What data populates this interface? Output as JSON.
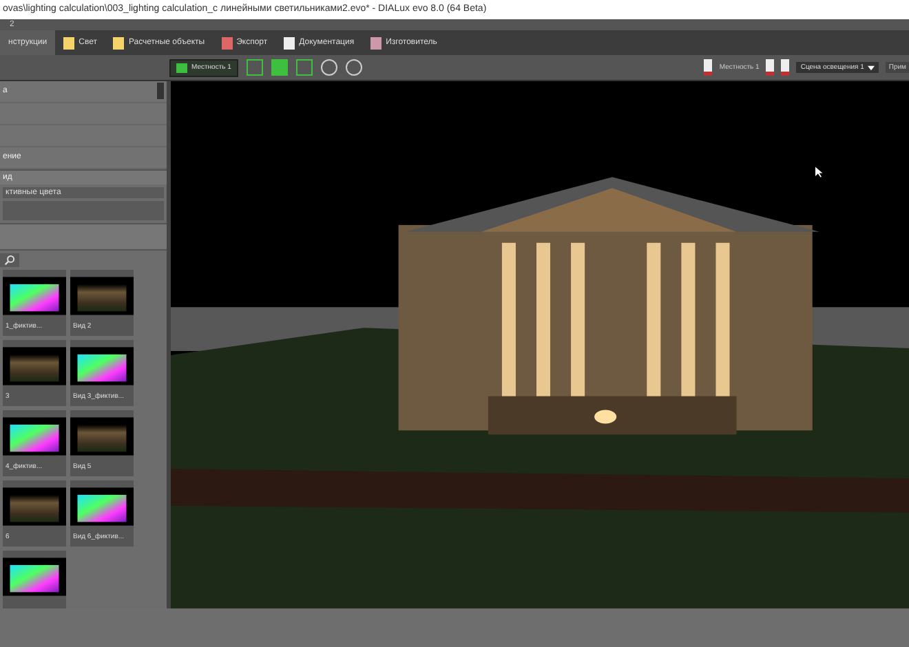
{
  "window": {
    "title": "ovas\\lighting calculation\\003_lighting calculation_с линейными светильниками2.evo* - DIALux evo 8.0 (64 Beta)"
  },
  "menu_bar": {
    "items": [
      "2"
    ]
  },
  "tabs": [
    {
      "label": "нструкции",
      "selected": true
    },
    {
      "label": "Свет",
      "selected": false
    },
    {
      "label": "Расчетные объекты",
      "selected": false
    },
    {
      "label": "Экспорт",
      "selected": false
    },
    {
      "label": "Документация",
      "selected": false
    },
    {
      "label": "Изготовитель",
      "selected": false
    }
  ],
  "right_toolbar": {
    "site": "Местность 1",
    "scene": "Сцена освещения 1",
    "cut_button": "Прим"
  },
  "view_toolbar": {
    "site_button": "Местность 1"
  },
  "side_panel": {
    "list_items": [
      "а",
      "ение"
    ],
    "section_title": "ид",
    "option": "ктивные цвета",
    "thumbnails": [
      {
        "label": "1_фиктив...",
        "kind": "false_color"
      },
      {
        "label": "Вид 2",
        "kind": "render"
      },
      {
        "label": "3",
        "kind": "render"
      },
      {
        "label": "Вид 3_фиктив...",
        "kind": "false_color"
      },
      {
        "label": "4_фиктив...",
        "kind": "false_color"
      },
      {
        "label": "Вид 5",
        "kind": "render"
      },
      {
        "label": "6",
        "kind": "render"
      },
      {
        "label": "Вид 6_фиктив...",
        "kind": "false_color"
      },
      {
        "kind": "false_color"
      }
    ]
  }
}
